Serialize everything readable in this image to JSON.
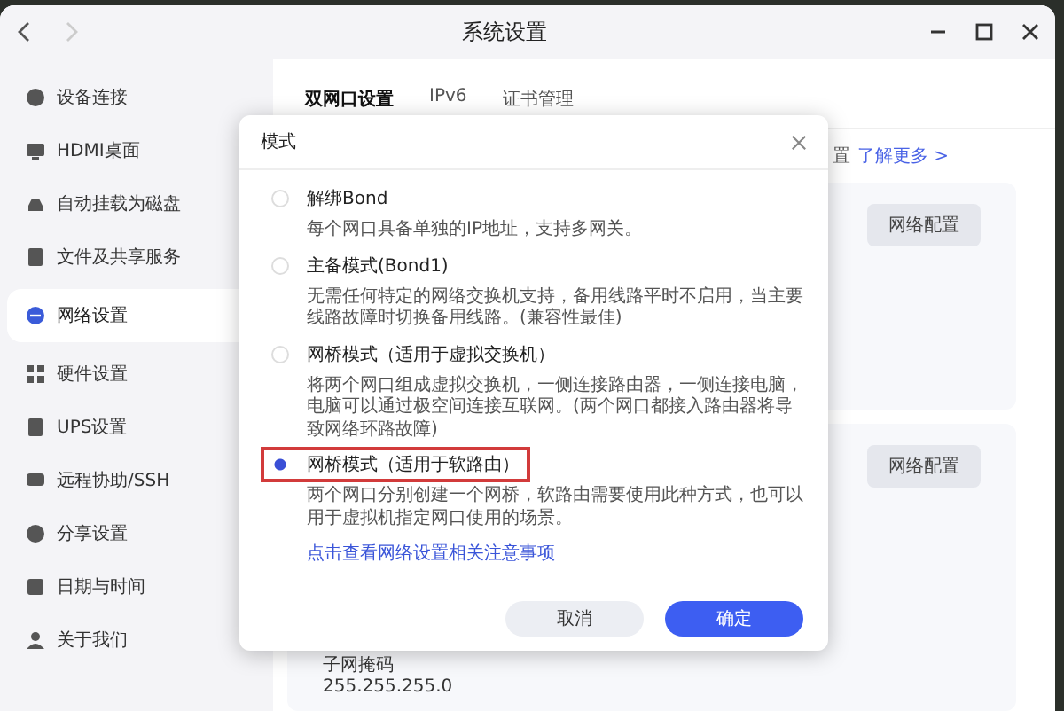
{
  "window": {
    "title": "系统设置"
  },
  "sidebar": {
    "items": [
      {
        "label": "设备连接",
        "selected": false
      },
      {
        "label": "HDMI桌面",
        "selected": false
      },
      {
        "label": "自动挂载为磁盘",
        "selected": false
      },
      {
        "label": "文件及共享服务",
        "selected": false
      },
      {
        "label": "网络设置",
        "selected": true
      },
      {
        "label": "硬件设置",
        "selected": false
      },
      {
        "label": "UPS设置",
        "selected": false
      },
      {
        "label": "远程协助/SSH",
        "selected": false
      },
      {
        "label": "分享设置",
        "selected": false
      },
      {
        "label": "日期与时间",
        "selected": false
      },
      {
        "label": "关于我们",
        "selected": false
      }
    ]
  },
  "tabs": [
    {
      "label": "双网口设置",
      "selected": true
    },
    {
      "label": "IPv6",
      "selected": false
    },
    {
      "label": "证书管理",
      "selected": false
    }
  ],
  "info": {
    "text": "置",
    "link": "了解更多 >"
  },
  "cards": [
    {
      "button": "网络配置"
    },
    {
      "button": "网络配置",
      "field_label": "子网掩码",
      "field_value": "255.255.255.0"
    }
  ],
  "dialog": {
    "title": "模式",
    "options": [
      {
        "title": "解绑Bond",
        "description": "每个网口具备单独的IP地址，支持多网关。",
        "selected": false,
        "highlighted": false
      },
      {
        "title": "主备模式(Bond1)",
        "description": "无需任何特定的网络交换机支持，备用线路平时不启用，当主要线路故障时切换备用线路。(兼容性最佳)",
        "selected": false,
        "highlighted": false
      },
      {
        "title": "网桥模式（适用于虚拟交换机）",
        "description": "将两个网口组成虚拟交换机，一侧连接路由器，一侧连接电脑，电脑可以通过极空间连接互联网。(两个网口都接入路由器将导致网络环路故障)",
        "selected": false,
        "highlighted": false
      },
      {
        "title": "网桥模式（适用于软路由）",
        "description": "两个网口分别创建一个网桥，软路由需要使用此种方式，也可以用于虚拟机指定网口使用的场景。",
        "selected": true,
        "highlighted": true
      }
    ],
    "link": "点击查看网络设置相关注意事项",
    "cancel": "取消",
    "confirm": "确定"
  }
}
